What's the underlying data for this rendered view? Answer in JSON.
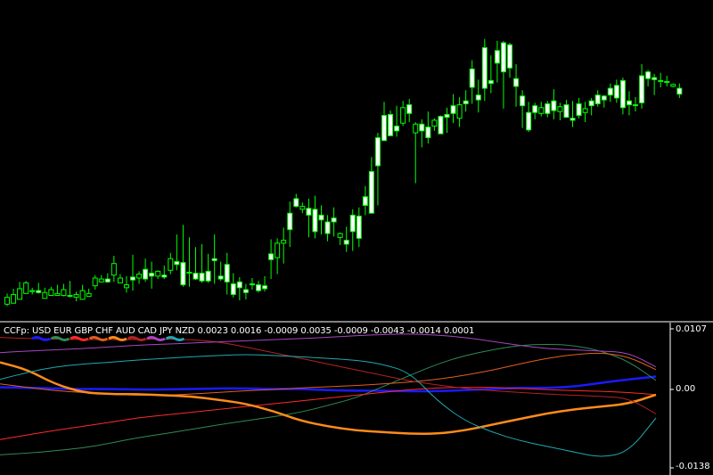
{
  "indicator": {
    "name": "CCFp:",
    "currencies": [
      "USD",
      "EUR",
      "GBP",
      "CHF",
      "AUD",
      "CAD",
      "JPY",
      "NZD"
    ],
    "values": [
      "0.0023",
      "0.0016",
      "-0.0009",
      "0.0035",
      "-0.0009",
      "-0.0043",
      "-0.0014",
      "0.0001"
    ],
    "axis_labels": {
      "top": "0.0107",
      "mid": "0.00",
      "bottom": "-0.0138"
    }
  },
  "colors": {
    "background": "#000000",
    "candle": "#00ff00",
    "bull_body": "#000000",
    "bear_body": "#ffffff",
    "separator": "#ffffff",
    "USD": "#1a1aff",
    "EUR": "#2e8b57",
    "GBP": "#ff2a2a",
    "CHF": "#e06020",
    "AUD": "#ff8c1a",
    "CAD": "#b22222",
    "JPY": "#a845c0",
    "NZD": "#20a8b0"
  },
  "chart_data": [
    {
      "type": "candlestick",
      "title": "",
      "grid": false,
      "price_scale_visible": false,
      "candles": [
        [
          312,
          314,
          301,
          305
        ],
        [
          311,
          306,
          296,
          302
        ],
        [
          307,
          304,
          289,
          296
        ],
        [
          301,
          299,
          288,
          290
        ],
        [
          299,
          302,
          295,
          298
        ],
        [
          298,
          301,
          290,
          300
        ],
        [
          306,
          304,
          295,
          300
        ],
        [
          303,
          302,
          294,
          297
        ],
        [
          303,
          299,
          292,
          301
        ],
        [
          303,
          304,
          291,
          297
        ],
        [
          303,
          305,
          288,
          303
        ],
        [
          305,
          309,
          299,
          302
        ],
        [
          307,
          304,
          292,
          298
        ],
        [
          304,
          302,
          296,
          301
        ],
        [
          293,
          297,
          282,
          285
        ],
        [
          289,
          288,
          282,
          286
        ],
        [
          286,
          290,
          280,
          289
        ],
        [
          282,
          289,
          262,
          270
        ],
        [
          290,
          290,
          281,
          285
        ],
        [
          295,
          300,
          283,
          292
        ],
        [
          284,
          298,
          261,
          287
        ],
        [
          285,
          291,
          278,
          281
        ],
        [
          276,
          289,
          265,
          286
        ],
        [
          280,
          296,
          268,
          283
        ],
        [
          283,
          286,
          277,
          278
        ],
        [
          282,
          286,
          272,
          284
        ],
        [
          277,
          281,
          259,
          265
        ],
        [
          268,
          277,
          240,
          271
        ],
        [
          269,
          294,
          230,
          292
        ],
        [
          279,
          294,
          243,
          279
        ],
        [
          280,
          287,
          253,
          286
        ],
        [
          280,
          290,
          250,
          288
        ],
        [
          278,
          290,
          260,
          288
        ],
        [
          265,
          291,
          240,
          267
        ],
        [
          283,
          288,
          268,
          286
        ],
        [
          271,
          302,
          259,
          289
        ],
        [
          291,
          305,
          280,
          302
        ],
        [
          289,
          308,
          284,
          295
        ],
        [
          297,
          307,
          291,
          300
        ],
        [
          291,
          297,
          285,
          292
        ],
        [
          292,
          300,
          288,
          298
        ],
        [
          293,
          299,
          283,
          296
        ],
        [
          260,
          286,
          245,
          266
        ],
        [
          264,
          281,
          244,
          249
        ],
        [
          249,
          270,
          233,
          246
        ],
        [
          218,
          253,
          206,
          235
        ],
        [
          203,
          212,
          198,
          211
        ],
        [
          214,
          218,
          207,
          211
        ],
        [
          213,
          243,
          203,
          220
        ],
        [
          214,
          244,
          200,
          237
        ],
        [
          220,
          240,
          210,
          225
        ],
        [
          227,
          247,
          220,
          239
        ],
        [
          223,
          242,
          212,
          227
        ],
        [
          243,
          251,
          238,
          239
        ],
        [
          246,
          258,
          232,
          250
        ],
        [
          220,
          257,
          214,
          237
        ],
        [
          221,
          253,
          212,
          244
        ],
        [
          201,
          220,
          190,
          210
        ],
        [
          175,
          215,
          160,
          218
        ],
        [
          140,
          210,
          135,
          169
        ],
        [
          117,
          136,
          103,
          143
        ],
        [
          116,
          131,
          112,
          138
        ],
        [
          128,
          139,
          107,
          133
        ],
        [
          125,
          128,
          102,
          109
        ],
        [
          106,
          124,
          100,
          115
        ],
        [
          135,
          187,
          124,
          126
        ],
        [
          126,
          150,
          121,
          133
        ],
        [
          129,
          146,
          113,
          140
        ],
        [
          128,
          133,
          120,
          122
        ],
        [
          118,
          130,
          117,
          136
        ],
        [
          116,
          135,
          109,
          119
        ],
        [
          107,
          125,
          95,
          115
        ],
        [
          120,
          129,
          98,
          106
        ],
        [
          102,
          113,
          91,
          105
        ],
        [
          69,
          105,
          60,
          88
        ],
        [
          96,
          114,
          80,
          101
        ],
        [
          47,
          102,
          38,
          89
        ],
        [
          81,
          94,
          55,
          84
        ],
        [
          50,
          83,
          40,
          63
        ],
        [
          42,
          110,
          40,
          72
        ],
        [
          44,
          78,
          42,
          68
        ],
        [
          79,
          108,
          64,
          87
        ],
        [
          97,
          130,
          91,
          107
        ],
        [
          114,
          134,
          103,
          132
        ],
        [
          107,
          121,
          104,
          114
        ],
        [
          115,
          118,
          103,
          109
        ],
        [
          105,
          119,
          102,
          115
        ],
        [
          102,
          121,
          90,
          112
        ],
        [
          113,
          122,
          104,
          108
        ],
        [
          106,
          116,
          101,
          119
        ],
        [
          120,
          129,
          102,
          122
        ],
        [
          105,
          120,
          99,
          117
        ],
        [
          114,
          124,
          103,
          110
        ],
        [
          102,
          117,
          99,
          107
        ],
        [
          96,
          108,
          91,
          105
        ],
        [
          97,
          109,
          96,
          101
        ],
        [
          89,
          103,
          84,
          96
        ],
        [
          86,
          104,
          80,
          99
        ],
        [
          81,
          116,
          78,
          109
        ],
        [
          102,
          117,
          92,
          106
        ],
        [
          106,
          113,
          98,
          106
        ],
        [
          76,
          110,
          64,
          104
        ],
        [
          72,
          87,
          70,
          79
        ],
        [
          78,
          96,
          74,
          80
        ],
        [
          81,
          88,
          73,
          81
        ],
        [
          83,
          87,
          76,
          82
        ],
        [
          87,
          88,
          84,
          85
        ],
        [
          89,
          99,
          84,
          95
        ]
      ]
    },
    {
      "type": "line",
      "title": "CCFp",
      "ylim": [
        -0.0138,
        0.0107
      ],
      "legend": "top-left",
      "series": [
        {
          "name": "USD",
          "values": [
            0.0004,
            0.0003,
            0.0002,
            0.0001,
            0.0001,
            0.0,
            0.0,
            0.0001,
            0.0002,
            0.0002,
            0.0001,
            0.0001,
            -0.0001,
            -0.0002,
            -0.0002,
            -0.0003,
            -0.0003,
            -0.0001,
            0.0001,
            0.0003,
            0.0003,
            0.0005,
            0.0012,
            0.0018,
            0.0023
          ]
        },
        {
          "name": "EUR",
          "values": [
            -0.0115,
            -0.0112,
            -0.0108,
            -0.0103,
            -0.0095,
            -0.0085,
            -0.0078,
            -0.007,
            -0.0062,
            -0.0055,
            -0.0048,
            -0.004,
            -0.0028,
            -0.0015,
            0.0005,
            0.0025,
            0.0045,
            0.006,
            0.007,
            0.0078,
            0.008,
            0.0078,
            0.0068,
            0.005,
            0.0016
          ]
        },
        {
          "name": "GBP",
          "values": [
            -0.0088,
            -0.008,
            -0.0072,
            -0.0065,
            -0.0058,
            -0.005,
            -0.0045,
            -0.004,
            -0.0035,
            -0.003,
            -0.0025,
            -0.002,
            -0.0015,
            -0.001,
            -0.0005,
            0.0,
            0.0003,
            0.0004,
            0.0004,
            0.0002,
            0.0,
            -0.0002,
            -0.0003,
            -0.0005,
            -0.0009
          ]
        },
        {
          "name": "CHF",
          "values": [
            0.001,
            0.0004,
            -0.0002,
            -0.0005,
            -0.0008,
            -0.001,
            -0.001,
            -0.0008,
            -0.0005,
            -0.0002,
            0.0,
            0.0003,
            0.0005,
            0.0007,
            0.001,
            0.0013,
            0.0018,
            0.0025,
            0.0034,
            0.0045,
            0.0055,
            0.0062,
            0.0065,
            0.0058,
            0.0035
          ]
        },
        {
          "name": "AUD",
          "values": [
            0.0048,
            0.0035,
            0.001,
            -0.0005,
            -0.0008,
            -0.0008,
            -0.001,
            -0.0012,
            -0.0018,
            -0.0025,
            -0.0038,
            -0.0055,
            -0.0065,
            -0.0072,
            -0.0075,
            -0.0078,
            -0.0078,
            -0.0072,
            -0.0062,
            -0.0052,
            -0.0042,
            -0.0035,
            -0.003,
            -0.0025,
            -0.0009
          ]
        },
        {
          "name": "CAD",
          "values": [
            0.0092,
            0.009,
            0.0089,
            0.0088,
            0.0088,
            0.0088,
            0.0089,
            0.0088,
            0.0084,
            0.0075,
            0.0065,
            0.0055,
            0.0045,
            0.0035,
            0.0025,
            0.0015,
            0.0008,
            0.0002,
            -0.0002,
            -0.0005,
            -0.0008,
            -0.001,
            -0.0012,
            -0.0015,
            -0.0043
          ]
        },
        {
          "name": "JPY",
          "values": [
            0.0065,
            0.0068,
            0.007,
            0.0072,
            0.0075,
            0.0078,
            0.008,
            0.0082,
            0.0084,
            0.0086,
            0.0088,
            0.009,
            0.0092,
            0.0095,
            0.0097,
            0.0098,
            0.0096,
            0.0092,
            0.0085,
            0.0078,
            0.0072,
            0.007,
            0.0068,
            0.0065,
            0.004
          ]
        },
        {
          "name": "NZD",
          "values": [
            0.0018,
            0.003,
            0.004,
            0.0045,
            0.0048,
            0.0052,
            0.0055,
            0.0058,
            0.006,
            0.0062,
            0.006,
            0.0058,
            0.0055,
            0.0052,
            0.0045,
            0.003,
            -0.002,
            -0.0055,
            -0.0075,
            -0.009,
            -0.01,
            -0.011,
            -0.012,
            -0.011,
            -0.005
          ]
        }
      ]
    }
  ]
}
